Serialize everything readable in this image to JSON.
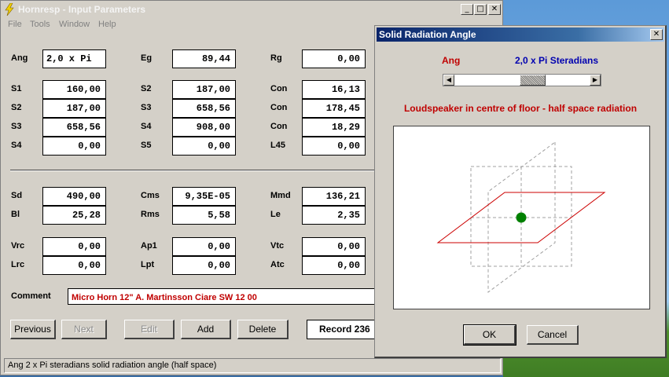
{
  "main_window": {
    "title": "Hornresp - Input Parameters",
    "menu": [
      "File",
      "Tools",
      "Window",
      "Help"
    ],
    "window_buttons": {
      "minimize": "_",
      "maximize": "□",
      "close": "✕"
    }
  },
  "params": {
    "ang": {
      "label": "Ang",
      "value": "2,0 x Pi"
    },
    "eg": {
      "label": "Eg",
      "value": "89,44"
    },
    "rg": {
      "label": "Rg",
      "value": "0,00"
    },
    "s1": {
      "label": "S1",
      "value": "160,00"
    },
    "s2_col2": {
      "label": "S2",
      "value": "187,00"
    },
    "con1": {
      "label": "Con",
      "value": "16,13"
    },
    "s2": {
      "label": "S2",
      "value": "187,00"
    },
    "s3_col2": {
      "label": "S3",
      "value": "658,56"
    },
    "con2": {
      "label": "Con",
      "value": "178,45"
    },
    "s3": {
      "label": "S3",
      "value": "658,56"
    },
    "s4_col2": {
      "label": "S4",
      "value": "908,00"
    },
    "con3": {
      "label": "Con",
      "value": "18,29"
    },
    "s4": {
      "label": "S4",
      "value": "0,00"
    },
    "s5": {
      "label": "S5",
      "value": "0,00"
    },
    "l45": {
      "label": "L45",
      "value": "0,00"
    },
    "sd": {
      "label": "Sd",
      "value": "490,00"
    },
    "cms": {
      "label": "Cms",
      "value": "9,35E-05"
    },
    "mmd": {
      "label": "Mmd",
      "value": "136,21"
    },
    "bl": {
      "label": "Bl",
      "value": "25,28"
    },
    "rms": {
      "label": "Rms",
      "value": "5,58"
    },
    "le": {
      "label": "Le",
      "value": "2,35"
    },
    "vrc": {
      "label": "Vrc",
      "value": "0,00"
    },
    "ap1": {
      "label": "Ap1",
      "value": "0,00"
    },
    "vtc": {
      "label": "Vtc",
      "value": "0,00"
    },
    "lrc": {
      "label": "Lrc",
      "value": "0,00"
    },
    "lpt": {
      "label": "Lpt",
      "value": "0,00"
    },
    "atc": {
      "label": "Atc",
      "value": "0,00"
    }
  },
  "comment": {
    "label": "Comment",
    "value": "Micro Horn 12\" A. Martinsson Ciare SW 12 00"
  },
  "buttons": {
    "previous": "Previous",
    "next": "Next",
    "edit": "Edit",
    "add": "Add",
    "delete": "Delete"
  },
  "record": "Record 236",
  "status": "Ang   2 x Pi steradians solid radiation angle  (half space)",
  "dialog": {
    "title": "Solid Radiation Angle",
    "close": "✕",
    "ang_label": "Ang",
    "ang_value": "2,0 x Pi Steradians",
    "slider_position": 0.6,
    "description": "Loudspeaker in centre of floor - half space radiation",
    "ok": "OK",
    "cancel": "Cancel"
  },
  "colors": {
    "red_text": "#c00000",
    "blue_text": "#0000b0",
    "speaker_dot": "#008000",
    "plane": "#cc0000"
  }
}
